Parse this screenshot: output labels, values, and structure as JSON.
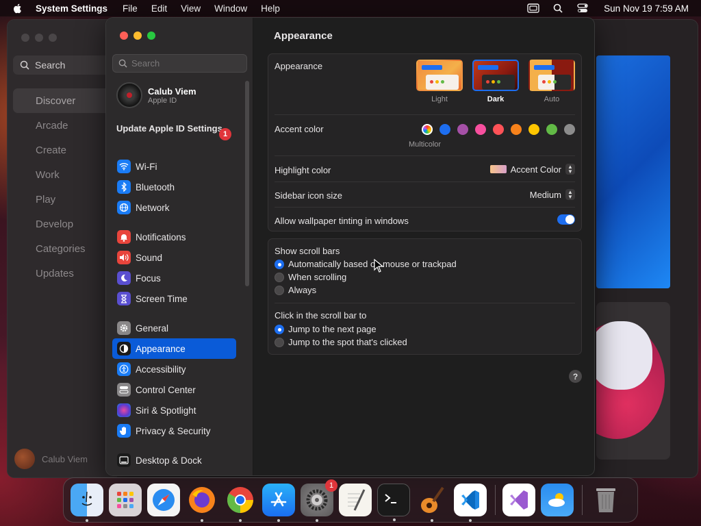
{
  "menubar": {
    "app_name": "System Settings",
    "items": [
      "File",
      "Edit",
      "View",
      "Window",
      "Help"
    ],
    "clock": "Sun Nov 19  7:59 AM"
  },
  "background_app": {
    "search_placeholder": "Search",
    "nav": [
      "Discover",
      "Arcade",
      "Create",
      "Work",
      "Play",
      "Develop",
      "Categories",
      "Updates"
    ],
    "user": "Calub Viem"
  },
  "settings": {
    "search_placeholder": "Search",
    "profile": {
      "name": "Calub Viem",
      "subtitle": "Apple ID"
    },
    "update": {
      "label": "Update Apple ID Settings",
      "badge": "1"
    },
    "sidebar": [
      {
        "label": "Wi-Fi",
        "icon": "wifi-icon",
        "color": "#1a7cf5"
      },
      {
        "label": "Bluetooth",
        "icon": "bluetooth-icon",
        "color": "#1a7cf5"
      },
      {
        "label": "Network",
        "icon": "globe-icon",
        "color": "#1a7cf5"
      },
      {
        "label": "Notifications",
        "icon": "bell-icon",
        "color": "#e8453c"
      },
      {
        "label": "Sound",
        "icon": "speaker-icon",
        "color": "#e8453c"
      },
      {
        "label": "Focus",
        "icon": "moon-icon",
        "color": "#5a4fd0"
      },
      {
        "label": "Screen Time",
        "icon": "hourglass-icon",
        "color": "#5a4fd0"
      },
      {
        "label": "General",
        "icon": "gear-icon",
        "color": "#8a8889"
      },
      {
        "label": "Appearance",
        "icon": "appearance-icon",
        "color": "#1a1a1a"
      },
      {
        "label": "Accessibility",
        "icon": "accessibility-icon",
        "color": "#1a7cf5"
      },
      {
        "label": "Control Center",
        "icon": "control-center-icon",
        "color": "#8a8889"
      },
      {
        "label": "Siri & Spotlight",
        "icon": "siri-icon",
        "color": "#b03ad0"
      },
      {
        "label": "Privacy & Security",
        "icon": "hand-icon",
        "color": "#1a7cf5"
      },
      {
        "label": "Desktop & Dock",
        "icon": "dock-icon",
        "color": "#1a1a1a"
      }
    ],
    "selected": "Appearance",
    "main": {
      "title": "Appearance",
      "appearance_label": "Appearance",
      "appearance_options": [
        "Light",
        "Dark",
        "Auto"
      ],
      "appearance_selected": "Dark",
      "accent_label": "Accent color",
      "accent_caption": "Multicolor",
      "accent_colors": [
        "#1d6ef0",
        "#a550a7",
        "#f74f9e",
        "#ff5257",
        "#f7821b",
        "#ffc600",
        "#62ba46",
        "#8c8c8c"
      ],
      "highlight_label": "Highlight color",
      "highlight_value": "Accent Color",
      "icon_size_label": "Sidebar icon size",
      "icon_size_value": "Medium",
      "tinting_label": "Allow wallpaper tinting in windows",
      "tinting_on": true,
      "scroll_bars_label": "Show scroll bars",
      "scroll_bars_options": [
        "Automatically based on mouse or trackpad",
        "When scrolling",
        "Always"
      ],
      "scroll_bars_selected": 0,
      "click_label": "Click in the scroll bar to",
      "click_options": [
        "Jump to the next page",
        "Jump to the spot that's clicked"
      ],
      "click_selected": 0,
      "help": "?"
    }
  },
  "dock": {
    "apps": [
      "finder-icon",
      "launchpad-icon",
      "safari-icon",
      "firefox-icon",
      "chrome-icon",
      "app-store-icon",
      "system-settings-icon",
      "textedit-icon",
      "terminal-icon",
      "garageband-icon",
      "vscode-icon"
    ],
    "settings_badge": "1",
    "recent": [
      "visual-studio-icon",
      "weather-icon"
    ],
    "trash": "trash-icon"
  }
}
